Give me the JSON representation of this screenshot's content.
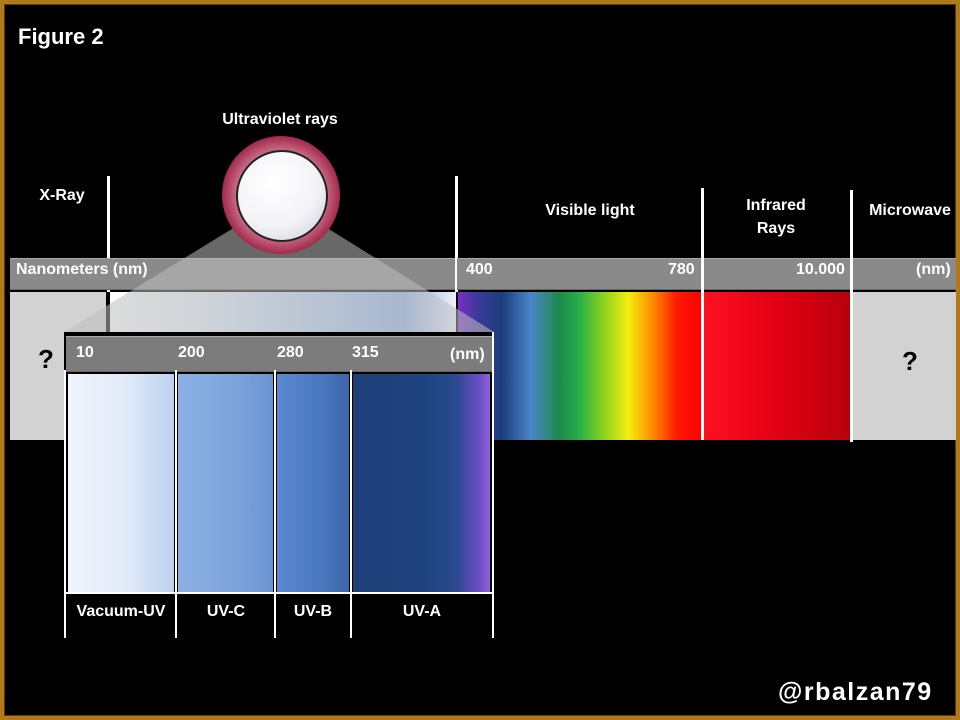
{
  "figure_label": "Figure 2",
  "categories": {
    "xray": "X-Ray",
    "uv": "Ultraviolet rays",
    "visible": "Visible light",
    "infrared_line1": "Infrared",
    "infrared_line2": "Rays",
    "microwave": "Microwave"
  },
  "main_scale": {
    "label": "Nanometers (nm)",
    "tick_400": "400",
    "tick_780": "780",
    "tick_10000": "10.000",
    "unit_right": "(nm)"
  },
  "unknown_marker": "?",
  "uv_detail": {
    "ticks": [
      "10",
      "200",
      "280",
      "315"
    ],
    "unit": "(nm)",
    "bands": [
      "Vacuum-UV",
      "UV-C",
      "UV-B",
      "UV-A"
    ]
  },
  "watermark": "@rbalzan79",
  "colors": {
    "frame": "#b07a1a",
    "scale_bar": "#8a8a8a",
    "unknown_box": "#d2d2d2",
    "infrared": "#e00010"
  }
}
